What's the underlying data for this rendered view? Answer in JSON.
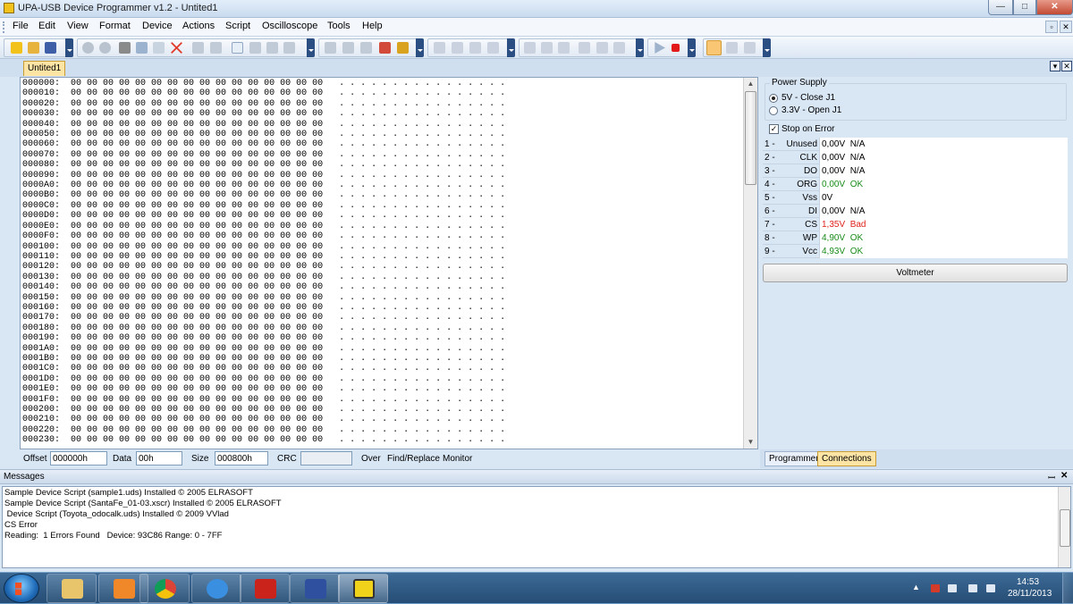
{
  "window": {
    "title": "UPA-USB Device Programmer v1.2 - Untited1",
    "min": "—",
    "max": "□",
    "close": "✕"
  },
  "menu": {
    "items": [
      "File",
      "Edit",
      "View",
      "Format",
      "Device",
      "Actions",
      "Script",
      "Oscilloscope",
      "Tools",
      "Help"
    ],
    "restore_label": "▫",
    "close_label": "✕"
  },
  "document": {
    "tab": "Untited1",
    "restore_label": "▾",
    "close_label": "✕"
  },
  "hex": {
    "rows": [
      "000000",
      "000010",
      "000020",
      "000030",
      "000040",
      "000050",
      "000060",
      "000070",
      "000080",
      "000090",
      "0000A0",
      "0000B0",
      "0000C0",
      "0000D0",
      "0000E0",
      "0000F0",
      "000100",
      "000110",
      "000120",
      "000130",
      "000140",
      "000150",
      "000160",
      "000170",
      "000180",
      "000190",
      "0001A0",
      "0001B0",
      "0001C0",
      "0001D0",
      "0001E0",
      "0001F0",
      "000200",
      "000210",
      "000220",
      "000230"
    ],
    "bytes": "00 00 00 00 00 00 00 00 00 00 00 00 00 00 00 00",
    "ascii": ". . . . . . . . . . . . . . . ."
  },
  "status": {
    "offset_label": "Offset",
    "offset_value": "000000h",
    "data_label": "Data",
    "data_value": "00h",
    "size_label": "Size",
    "size_value": "000800h",
    "crc_label": "CRC",
    "crc_value": "",
    "over_label": "Over",
    "find_label": "Find/Replace",
    "monitor_label": "Monitor"
  },
  "power_supply": {
    "legend": "Power Supply",
    "options": [
      {
        "label": "5V - Close J1",
        "selected": true
      },
      {
        "label": "3.3V - Open J1",
        "selected": false
      }
    ],
    "stop_on_error": {
      "label": "Stop on Error",
      "checked": true
    }
  },
  "pins": [
    {
      "num": "1 -",
      "name": "Unused",
      "voltage": "0,00V",
      "status": "N/A",
      "state": "na"
    },
    {
      "num": "2 -",
      "name": "CLK",
      "voltage": "0,00V",
      "status": "N/A",
      "state": "na"
    },
    {
      "num": "3 -",
      "name": "DO",
      "voltage": "0,00V",
      "status": "N/A",
      "state": "na"
    },
    {
      "num": "4 -",
      "name": "ORG",
      "voltage": "0,00V",
      "status": "OK",
      "state": "ok"
    },
    {
      "num": "5 -",
      "name": "Vss",
      "voltage": "0V",
      "status": "",
      "state": "na"
    },
    {
      "num": "6 -",
      "name": "DI",
      "voltage": "0,00V",
      "status": "N/A",
      "state": "na"
    },
    {
      "num": "7 -",
      "name": "CS",
      "voltage": "1,35V",
      "status": "Bad",
      "state": "bad"
    },
    {
      "num": "8 -",
      "name": "WP",
      "voltage": "4,90V",
      "status": "OK",
      "state": "ok"
    },
    {
      "num": "9 -",
      "name": "Vcc",
      "voltage": "4,93V",
      "status": "OK",
      "state": "ok"
    }
  ],
  "voltmeter_label": "Voltmeter",
  "panel_tabs": {
    "programmer": "Programmer",
    "connections": "Connections"
  },
  "messages": {
    "title": "Messages",
    "pin_label": "ꟷ",
    "close_label": "✕",
    "lines": [
      "Sample Device Script (sample1.uds) Installed © 2005 ELRASOFT",
      "Sample Device Script (SantaFe_01-03.xscr) Installed © 2005 ELRASOFT",
      " Device Script (Toyota_odocalk.uds) Installed © 2009 VVlad",
      "CS Error",
      "Reading:  1 Errors Found   Device: 93C86 Range: 0 - 7FF"
    ]
  },
  "taskbar": {
    "apps": [
      "windows-explorer",
      "media-player",
      "chrome",
      "internet-explorer",
      "acrobat",
      "floppy-save",
      "upa-usb-programmer"
    ],
    "time": "14:53",
    "date": "28/11/2013"
  },
  "colors": {
    "ok": "#1a8c1a",
    "bad": "#e0221a",
    "tab_active": "#fce4a4"
  }
}
